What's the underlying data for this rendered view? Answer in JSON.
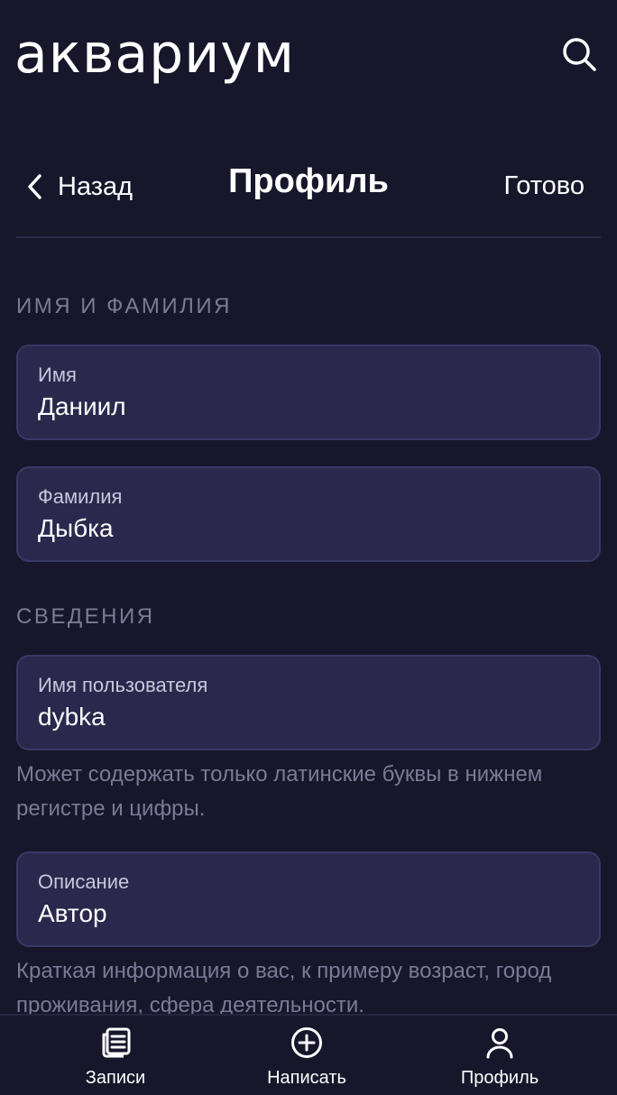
{
  "header": {
    "logo_text": "аквариум",
    "search_icon": "search-icon"
  },
  "nav": {
    "back_label": "Назад",
    "title": "Профиль",
    "done_label": "Готово"
  },
  "sections": {
    "name": {
      "header": "ИМЯ И ФАМИЛИЯ",
      "first_name": {
        "label": "Имя",
        "value": "Даниил"
      },
      "last_name": {
        "label": "Фамилия",
        "value": "Дыбка"
      }
    },
    "info": {
      "header": "СВЕДЕНИЯ",
      "username": {
        "label": "Имя пользователя",
        "value": "dybka",
        "hint": "Может содержать только латинские буквы в нижнем регистре и цифры."
      },
      "description": {
        "label": "Описание",
        "value": "Автор",
        "hint": "Краткая информация о вас, к примеру возраст, город проживания, сфера деятельности."
      }
    }
  },
  "tabs": [
    {
      "label": "Записи",
      "icon": "posts-icon"
    },
    {
      "label": "Написать",
      "icon": "plus-circle-icon"
    },
    {
      "label": "Профиль",
      "icon": "user-icon"
    }
  ],
  "colors": {
    "background": "#17162b",
    "field_background": "#2a284c",
    "field_border": "#3a3866",
    "muted_text": "#7c7b96"
  }
}
